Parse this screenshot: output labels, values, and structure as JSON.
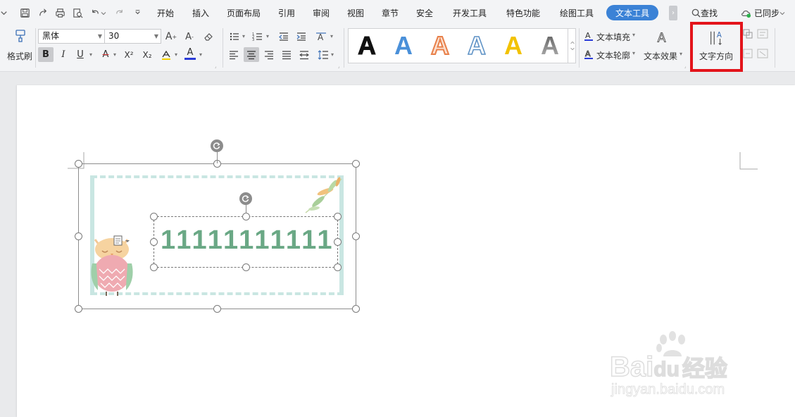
{
  "menubar": {
    "items": [
      "开始",
      "插入",
      "页面布局",
      "引用",
      "审阅",
      "视图",
      "章节",
      "安全",
      "开发工具",
      "特色功能",
      "绘图工具"
    ],
    "active_tab": "文本工具",
    "more_arrow": "›",
    "search_label": "查找",
    "sync_label": "已同步"
  },
  "ribbon": {
    "format_painter": "格式刷",
    "font_name": "黑体",
    "font_size": "30",
    "bold": "B",
    "italic": "I",
    "underline": "U",
    "strike": "A",
    "superscript": "X²",
    "subscript": "X₂",
    "font_color": "A",
    "text_styles": [
      {
        "glyph": "A",
        "color": "#111111"
      },
      {
        "glyph": "A",
        "color": "#4a90d9"
      },
      {
        "glyph": "A",
        "color": "#e8804a"
      },
      {
        "glyph": "A",
        "color": "#5a8fc4"
      },
      {
        "glyph": "A",
        "color": "#f2c200"
      },
      {
        "glyph": "A",
        "color": "#777777"
      }
    ],
    "text_fill": "文本填充",
    "text_outline": "文本轮廓",
    "text_effect": "文本效果",
    "text_direction": "文字方向"
  },
  "document": {
    "textbox_content": "11111111111"
  },
  "watermark": {
    "brand_left": "Bai",
    "brand_du": "du",
    "brand_cn": "经验",
    "url": "jingyan.baidu.com"
  },
  "colors": {
    "accent": "#3b82d6",
    "highlight": "#e3141b",
    "text_green": "#6aa885",
    "deco_teal": "#c9e6e2"
  }
}
